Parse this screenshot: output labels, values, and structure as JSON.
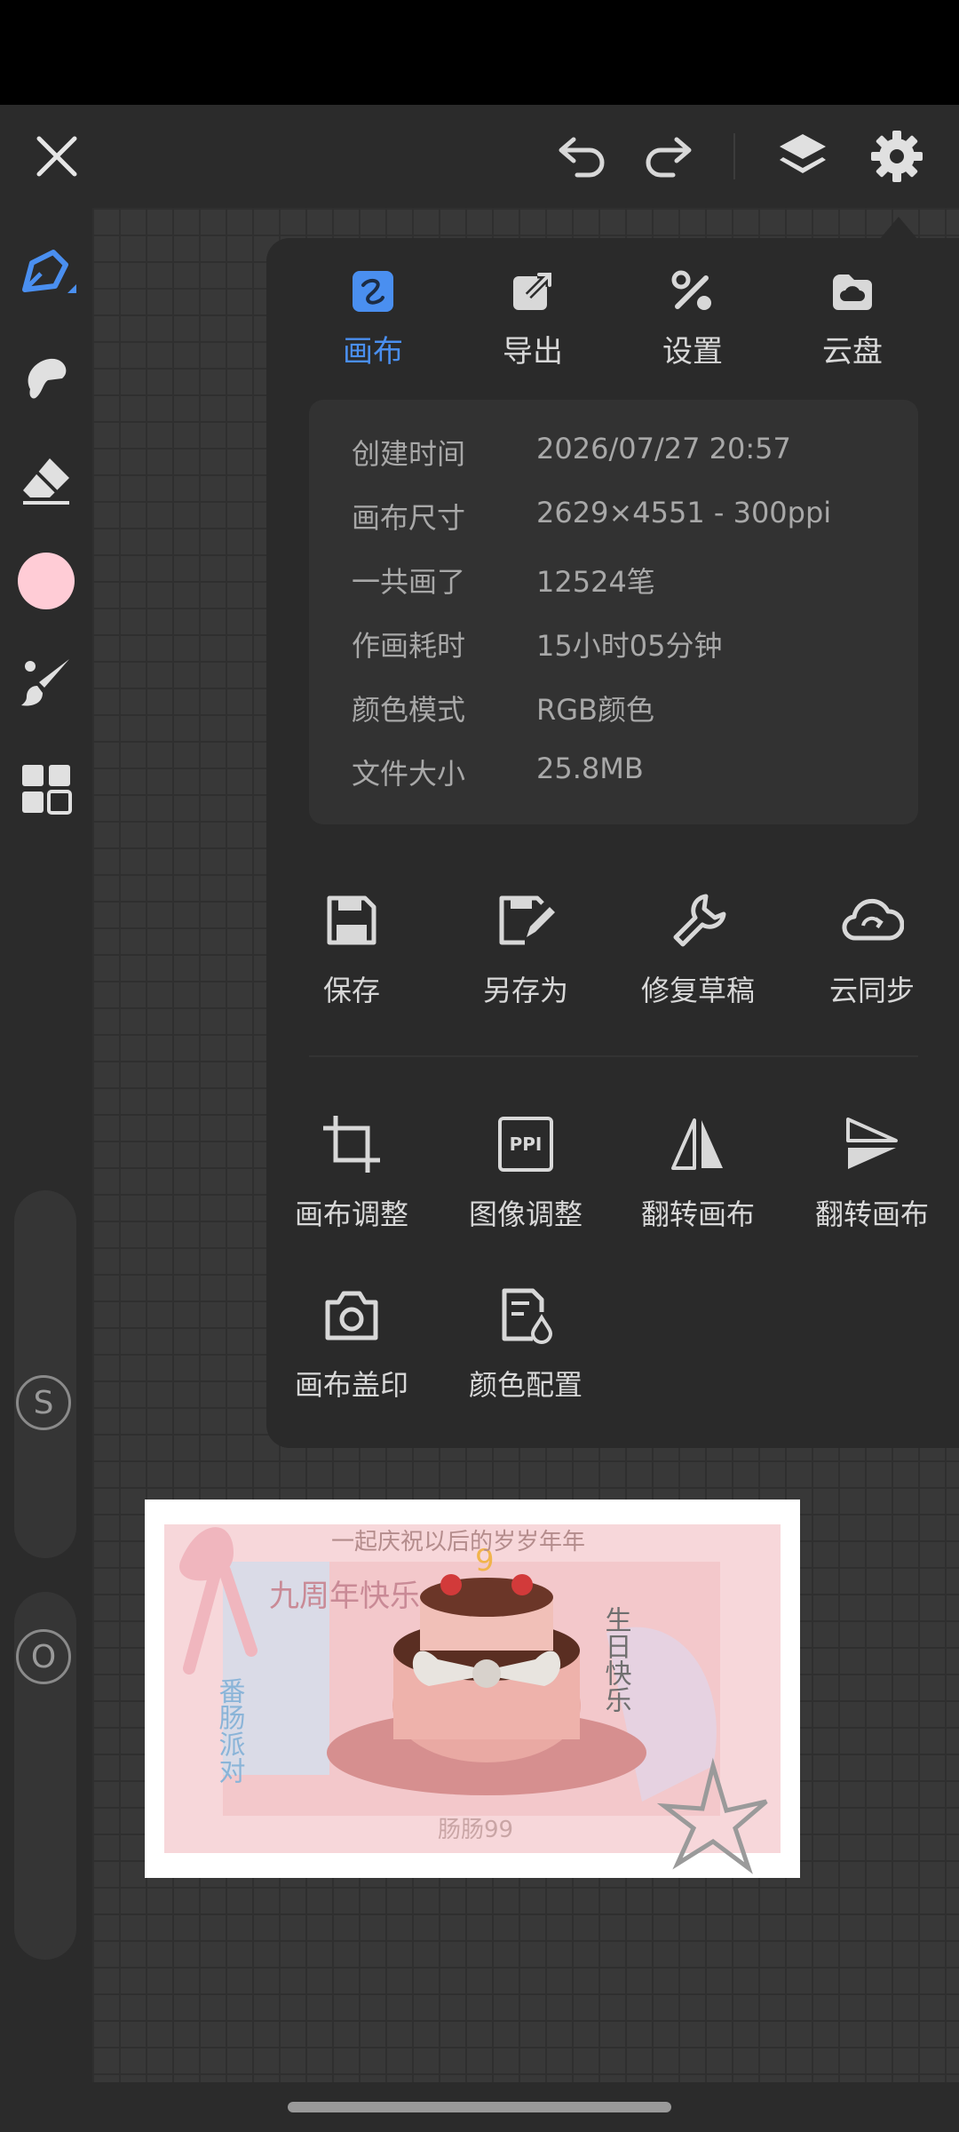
{
  "colors": {
    "accent": "#4a8ff0",
    "current_color": "#ffccd6"
  },
  "toolbar": {
    "close_icon": "close-icon",
    "undo_icon": "undo-icon",
    "redo_icon": "redo-icon",
    "layers_icon": "layers-icon",
    "settings_icon": "gear-icon"
  },
  "sidebar": {
    "tools": [
      "brush-tool-icon",
      "smudge-tool-icon",
      "eraser-tool-icon",
      "color-swatch",
      "paint-brush-icon",
      "grid-menu-icon"
    ],
    "size_slider_label": "S",
    "opacity_slider_label": "O"
  },
  "panel": {
    "tabs": [
      {
        "label": "画布",
        "icon": "canvas-icon",
        "active": true
      },
      {
        "label": "导出",
        "icon": "export-icon",
        "active": false
      },
      {
        "label": "设置",
        "icon": "tools-icon",
        "active": false
      },
      {
        "label": "云盘",
        "icon": "cloud-drive-icon",
        "active": false
      }
    ],
    "info": [
      {
        "key": "创建时间",
        "value": "2026/07/27 20:57"
      },
      {
        "key": "画布尺寸",
        "value": "2629×4551 - 300ppi"
      },
      {
        "key": "一共画了",
        "value": "12524笔"
      },
      {
        "key": "作画耗时",
        "value": "15小时05分钟"
      },
      {
        "key": "颜色模式",
        "value": "RGB颜色"
      },
      {
        "key": "文件大小",
        "value": "25.8MB"
      }
    ],
    "file_actions": [
      {
        "label": "保存",
        "icon": "save-icon"
      },
      {
        "label": "另存为",
        "icon": "save-as-icon"
      },
      {
        "label": "修复草稿",
        "icon": "wrench-icon"
      },
      {
        "label": "云同步",
        "icon": "cloud-sync-icon"
      }
    ],
    "canvas_actions": [
      {
        "label": "画布调整",
        "icon": "crop-icon"
      },
      {
        "label": "图像调整",
        "icon": "ppi-icon",
        "icon_text": "PPI"
      },
      {
        "label": "翻转画布",
        "icon": "flip-horizontal-icon"
      },
      {
        "label": "翻转画布",
        "icon": "flip-vertical-icon"
      },
      {
        "label": "画布盖印",
        "icon": "camera-icon"
      },
      {
        "label": "颜色配置",
        "icon": "color-config-icon"
      }
    ]
  },
  "artwork": {
    "top_text": "一起庆祝以后的岁岁年年",
    "left_text": "九周年快乐",
    "right_text": "生日快乐",
    "side_text": "番肠派对",
    "bottom_text": "肠肠99",
    "cake_number": "9"
  }
}
